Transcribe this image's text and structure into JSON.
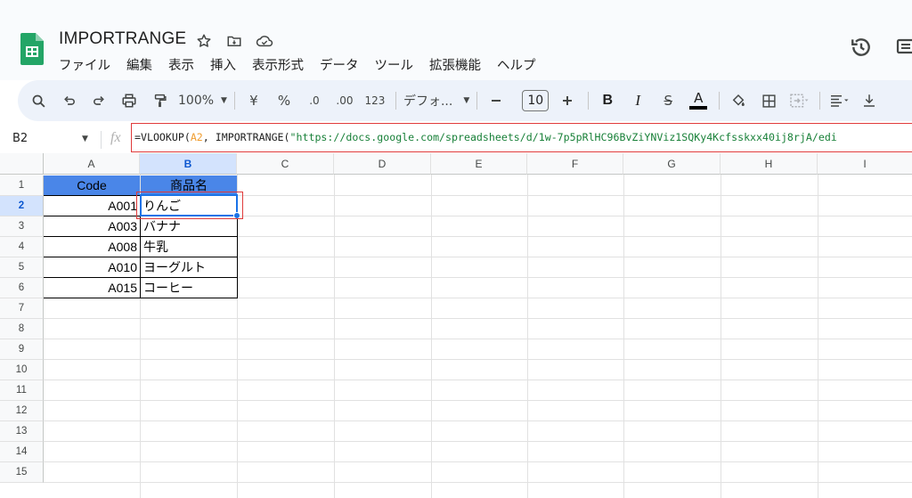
{
  "app": {
    "title": "IMPORTRANGE",
    "title_icons": [
      "star-icon",
      "move-to-folder-icon",
      "cloud-saved-icon"
    ],
    "menu": [
      "ファイル",
      "編集",
      "表示",
      "挿入",
      "表示形式",
      "データ",
      "ツール",
      "拡張機能",
      "ヘルプ"
    ],
    "right_icons": [
      "version-history-icon",
      "comments-icon"
    ]
  },
  "toolbar": {
    "zoom": "100%",
    "currency": "¥",
    "percent": "%",
    "dec_decrease": ".0",
    "dec_increase": ".00",
    "number_format": "123",
    "font": "デフォ...",
    "font_size": "10",
    "bold": "B",
    "italic": "I",
    "strike": "S",
    "text_color": "A",
    "colors": {
      "toolbar_bg": "#edf2fa",
      "selection": "#1a73e8",
      "header_fill": "#4a86e8",
      "highlight_border": "#e03b3b"
    }
  },
  "formula_bar": {
    "name_box": "B2",
    "fx": "fx",
    "formula_prefix": "=VLOOKUP(",
    "formula_ref": "A2",
    "formula_mid": ", IMPORTRANGE(",
    "formula_url": "\"https://docs.google.com/spreadsheets/d/1w-7p5pRlHC96BvZiYNViz1SQKy4Kcfsskxx40ij8rjA/edi"
  },
  "grid": {
    "columns": [
      "A",
      "B",
      "C",
      "D",
      "E",
      "F",
      "G",
      "H",
      "I"
    ],
    "selected_column": "B",
    "rows": [
      "1",
      "2",
      "3",
      "4",
      "5",
      "6",
      "7",
      "8",
      "9",
      "10",
      "11",
      "12",
      "13",
      "14",
      "15"
    ],
    "selected_row": "2",
    "active_cell": "B2",
    "table": {
      "headers": [
        "Code",
        "商品名"
      ],
      "rows": [
        [
          "A001",
          "りんご"
        ],
        [
          "A003",
          "バナナ"
        ],
        [
          "A008",
          "牛乳"
        ],
        [
          "A010",
          "ヨーグルト"
        ],
        [
          "A015",
          "コーヒー"
        ]
      ]
    }
  }
}
